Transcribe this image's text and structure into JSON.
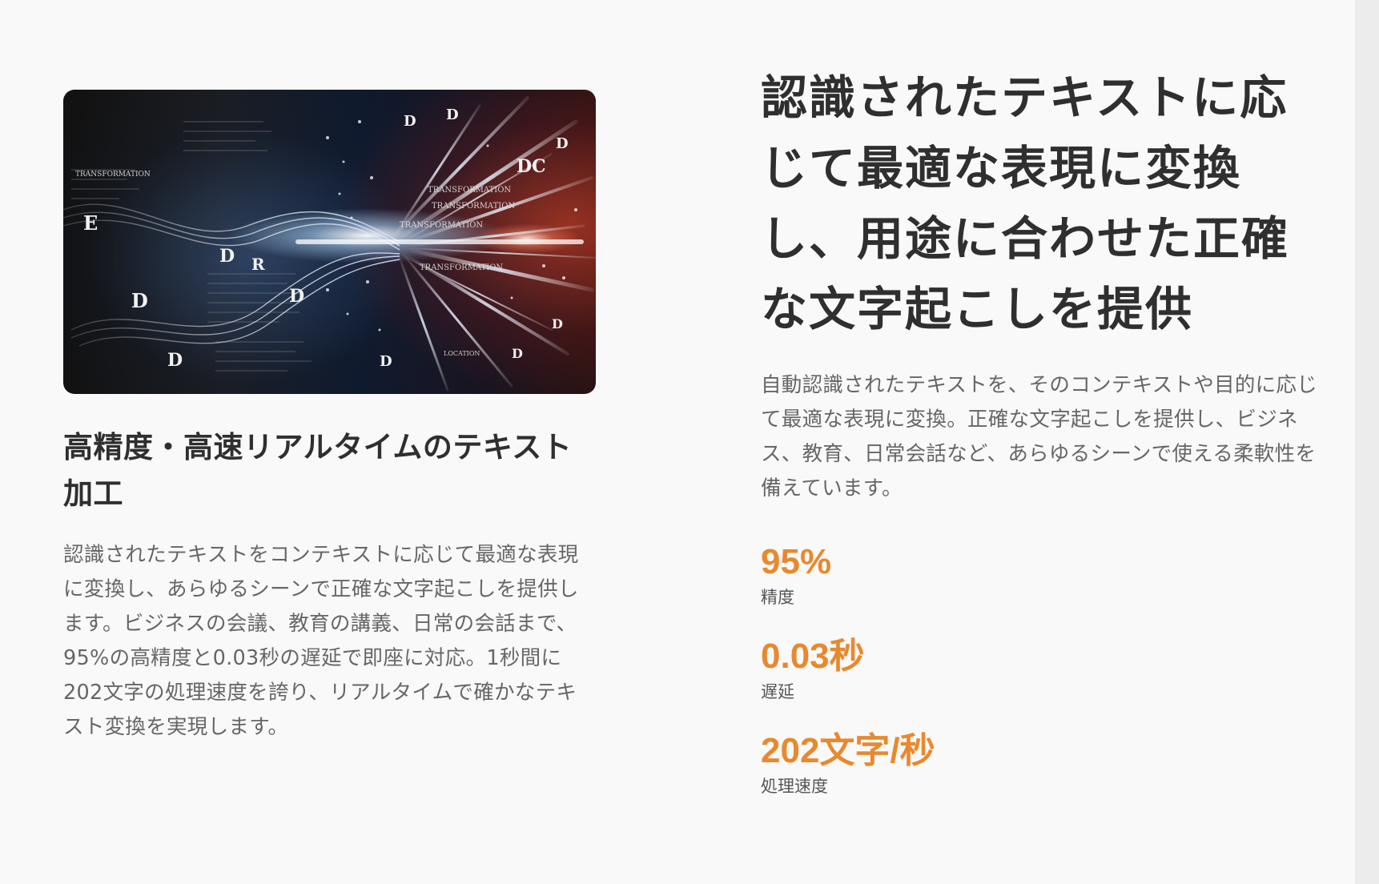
{
  "colors": {
    "background": "#f9f9f9",
    "heading": "#2f2f2f",
    "body_text": "#666666",
    "accent": "#e8892f"
  },
  "feature_card": {
    "image_alt": "Abstract visualization of text transformation with flying letters and light streaks",
    "image_overlay_texts": [
      "TRANSFORMATION",
      "TRANSFORMATION",
      "TRANSFORMATION",
      "DC",
      "E",
      "D",
      "D",
      "D",
      "R",
      "D"
    ],
    "heading": "高精度・高速リアルタイムのテキスト加工",
    "body": "認識されたテキストをコンテキストに応じて最適な表現に変換し、あらゆるシーンで正確な文字起こしを提供します。ビジネスの会議、教育の講義、日常の会話まで、95%の高精度と0.03秒の遅延で即座に対応。1秒間に202文字の処理速度を誇り、リアルタイムで確かなテキスト変換を実現します。"
  },
  "hero": {
    "heading": "認識されたテキストに応じて最適な表現に変換し、用途に合わせた正確な文字起こしを提供",
    "description": "自動認識されたテキストを、そのコンテキストや目的に応じて最適な表現に変換。正確な文字起こしを提供し、ビジネス、教育、日常会話など、あらゆるシーンで使える柔軟性を備えています。"
  },
  "stats": [
    {
      "value": "95%",
      "label": "精度"
    },
    {
      "value": "0.03秒",
      "label": "遅延"
    },
    {
      "value": "202文字/秒",
      "label": "処理速度"
    }
  ]
}
